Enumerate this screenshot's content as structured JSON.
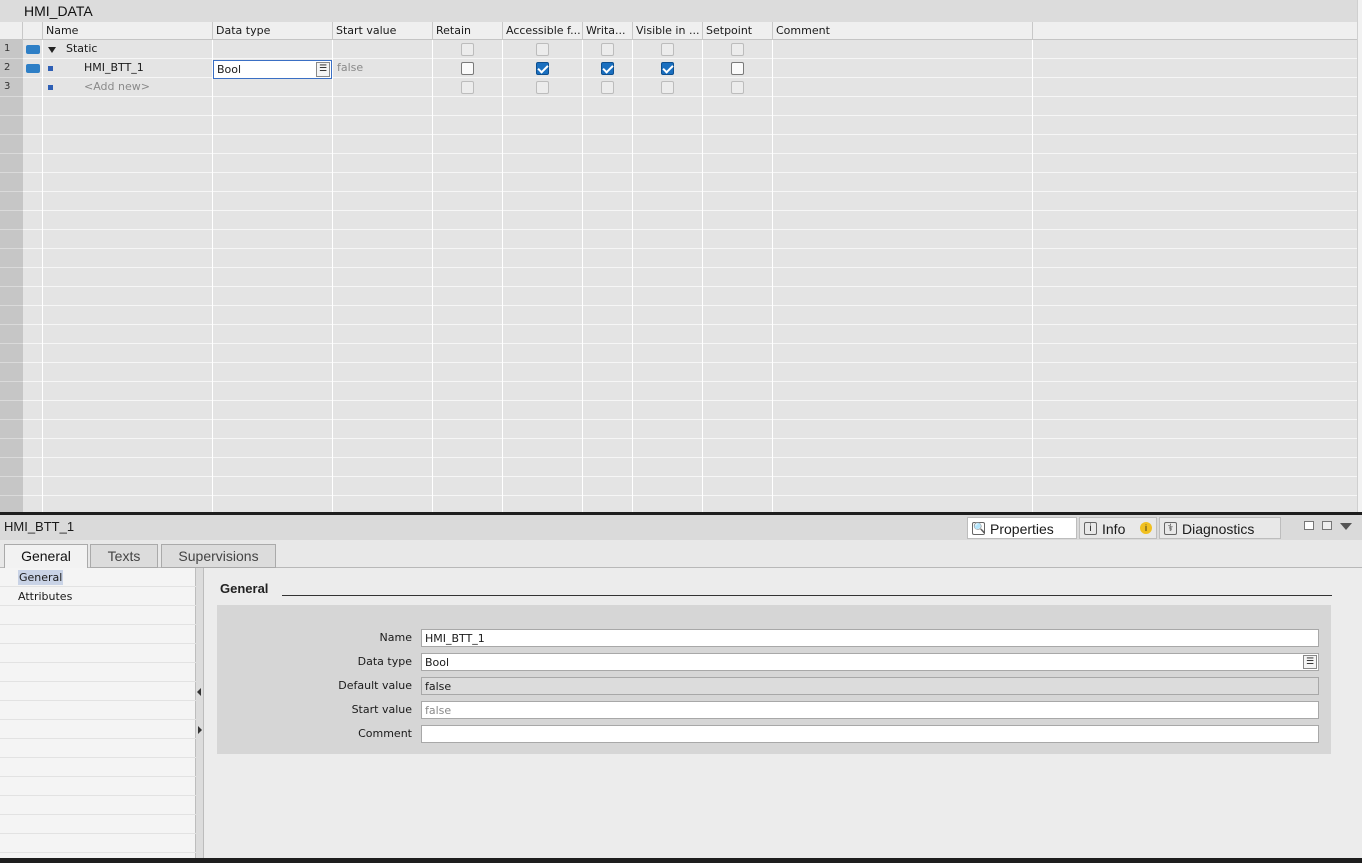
{
  "block": {
    "title": "HMI_DATA"
  },
  "table": {
    "headers": [
      "Name",
      "Data type",
      "Start value",
      "Retain",
      "Accessible f...",
      "Writa...",
      "Visible in ...",
      "Setpoint",
      "Comment"
    ],
    "rows": [
      {
        "num": "1",
        "name": "Static",
        "datatype": "",
        "start": "",
        "retain": false,
        "accessible": false,
        "writable": false,
        "visible": false,
        "setpoint": false
      },
      {
        "num": "2",
        "name": "HMI_BTT_1",
        "datatype": "Bool",
        "start": "false",
        "retain": false,
        "accessible": true,
        "writable": true,
        "visible": true,
        "setpoint": false
      },
      {
        "num": "3",
        "name": "<Add new>",
        "datatype": "",
        "start": "",
        "retain": false,
        "accessible": false,
        "writable": false,
        "visible": false,
        "setpoint": false
      }
    ]
  },
  "inspector": {
    "selected": "HMI_BTT_1",
    "tabs": [
      "Properties",
      "Info",
      "Diagnostics"
    ],
    "subtabs": [
      "General",
      "Texts",
      "Supervisions"
    ],
    "nav": [
      "General",
      "Attributes"
    ],
    "section": "General",
    "fields": [
      {
        "label": "Name",
        "value": "HMI_BTT_1"
      },
      {
        "label": "Data type",
        "value": "Bool"
      },
      {
        "label": "Default value",
        "value": "false"
      },
      {
        "label": "Start value",
        "value": "false"
      },
      {
        "label": "Comment",
        "value": ""
      }
    ]
  },
  "colors": {
    "accent": "#1a6fbf",
    "checkbox_on": "#1a6fbf",
    "selection": "#c9d3e6"
  }
}
